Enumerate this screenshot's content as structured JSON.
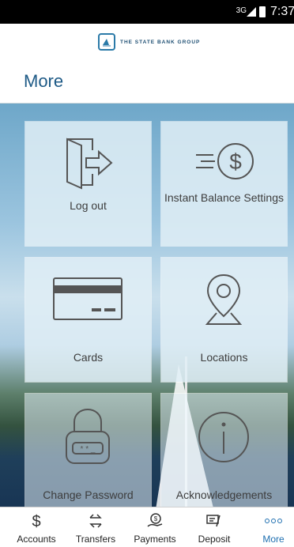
{
  "status_bar": {
    "network": "3G",
    "time": "7:37"
  },
  "header": {
    "bank_name": "THE STATE BANK GROUP",
    "title": "More"
  },
  "tiles": [
    {
      "label": "Log out"
    },
    {
      "label": "Instant Balance Settings"
    },
    {
      "label": "Cards"
    },
    {
      "label": "Locations"
    },
    {
      "label": "Change Password"
    },
    {
      "label": "Acknowledgements"
    }
  ],
  "tab_bar": [
    {
      "label": "Accounts",
      "icon": "dollar-icon"
    },
    {
      "label": "Transfers",
      "icon": "transfer-arrows-icon"
    },
    {
      "label": "Payments",
      "icon": "payment-hand-icon"
    },
    {
      "label": "Deposit",
      "icon": "check-deposit-icon"
    },
    {
      "label": "More",
      "icon": "more-dots-icon",
      "active": true
    }
  ],
  "colors": {
    "accent": "#1e6fb0",
    "title": "#1e5a86",
    "icon_stroke": "#555555"
  }
}
